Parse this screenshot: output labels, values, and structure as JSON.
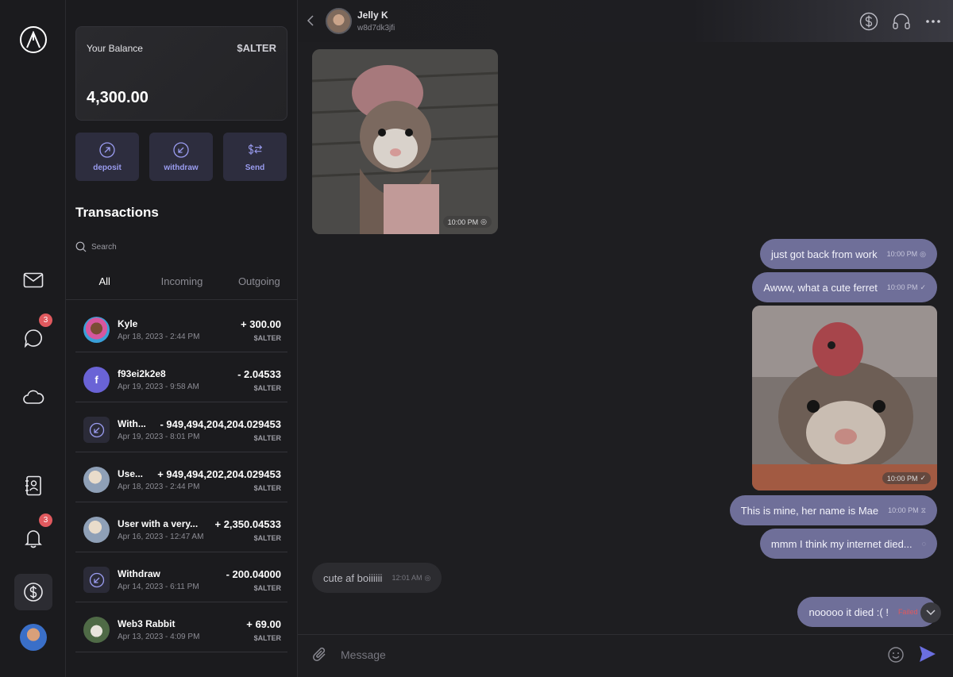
{
  "nav": {
    "chat_badge": "3",
    "notifications_badge": "3"
  },
  "wallet": {
    "balance_label": "Your Balance",
    "currency": "$ALTER",
    "balance": "4,300.00",
    "actions": [
      {
        "label": "deposit",
        "icon": "arrow-up-right-circle-icon"
      },
      {
        "label": "withdraw",
        "icon": "arrow-down-left-circle-icon"
      },
      {
        "label": "Send",
        "icon": "dollar-arrow-icon"
      }
    ],
    "transactions_title": "Transactions",
    "search_placeholder": "Search",
    "tabs": [
      "All",
      "Incoming",
      "Outgoing"
    ],
    "active_tab": "All",
    "transactions": [
      {
        "name": "Kyle",
        "date": "Apr 18, 2023 - 2:44 PM",
        "amount": "+ 300.00",
        "unit": "$ALTER",
        "avatar": "photo"
      },
      {
        "name": "f93ei2k2e8",
        "date": "Apr 19, 2023 - 9:58 AM",
        "amount": "- 2.04533",
        "unit": "$ALTER",
        "avatar": "f"
      },
      {
        "name": "With...",
        "date": "Apr 19, 2023 - 8:01 PM",
        "amount": "- 949,494,204,204.029453",
        "unit": "$ALTER",
        "avatar": "withdraw-icon"
      },
      {
        "name": "Use...",
        "date": "Apr 18, 2023 - 2:44 PM",
        "amount": "+ 949,494,202,204.029453",
        "unit": "$ALTER",
        "avatar": "photo"
      },
      {
        "name": "User with a very...",
        "date": "Apr 16, 2023 - 12:47 AM",
        "amount": "+ 2,350.04533",
        "unit": "$ALTER",
        "avatar": "photo"
      },
      {
        "name": "Withdraw",
        "date": "Apr 14, 2023 - 6:11 PM",
        "amount": "- 200.04000",
        "unit": "$ALTER",
        "avatar": "withdraw-icon"
      },
      {
        "name": "Web3 Rabbit",
        "date": "Apr 13, 2023 - 4:09 PM",
        "amount": "+ 69.00",
        "unit": "$ALTER",
        "avatar": "photo"
      }
    ]
  },
  "chat": {
    "peer_name": "Jelly K",
    "peer_id": "w8d7dk3jfi",
    "messages": [
      {
        "type": "image",
        "direction": "in",
        "time": "10:00 PM",
        "status": "seen"
      },
      {
        "type": "text",
        "direction": "out",
        "text": "just got back from work",
        "time": "10:00 PM",
        "status": "seen"
      },
      {
        "type": "text",
        "direction": "out",
        "text": "Awww, what a cute ferret",
        "time": "10:00 PM",
        "status": "sent"
      },
      {
        "type": "image",
        "direction": "out",
        "time": "10:00 PM",
        "status": "sent"
      },
      {
        "type": "text",
        "direction": "out",
        "text": "This is mine, her name is Mae",
        "time": "10:00 PM",
        "status": "pending"
      },
      {
        "type": "text",
        "direction": "out",
        "text": "mmm I think my internet died...",
        "time": "",
        "status": "sending"
      },
      {
        "type": "text",
        "direction": "in",
        "text": "cute af boiiiiii",
        "time": "12:01 AM",
        "status": "seen"
      },
      {
        "type": "text",
        "direction": "out",
        "text": "nooooo it died :( !",
        "time": "Failed",
        "status": "failed"
      }
    ],
    "composer_placeholder": "Message"
  },
  "colors": {
    "accent": "#9a9cf0",
    "bubble_out": "#6f6f99",
    "badge": "#e0595e",
    "failed": "#e0595e"
  }
}
